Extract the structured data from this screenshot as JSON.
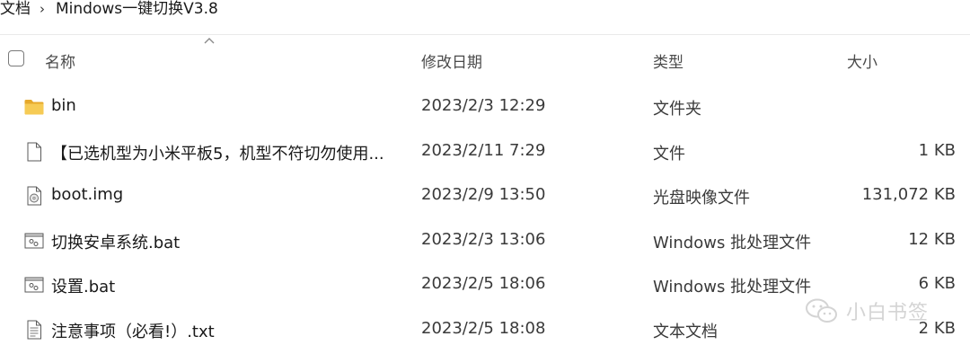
{
  "breadcrumb": {
    "items": [
      "文档",
      "Mindows一键切换V3.8"
    ],
    "separator": "›"
  },
  "columns": {
    "name": "名称",
    "date_modified": "修改日期",
    "type": "类型",
    "size": "大小"
  },
  "files": [
    {
      "icon": "folder-icon",
      "name": "bin",
      "date": "2023/2/3 12:29",
      "type": "文件夹",
      "size": ""
    },
    {
      "icon": "file-icon",
      "name": "【已选机型为小米平板5，机型不符切勿使用...",
      "date": "2023/2/11 7:29",
      "type": "文件",
      "size": "1 KB"
    },
    {
      "icon": "disc-image-icon",
      "name": "boot.img",
      "date": "2023/2/9 13:50",
      "type": "光盘映像文件",
      "size": "131,072 KB"
    },
    {
      "icon": "batch-file-icon",
      "name": "切换安卓系统.bat",
      "date": "2023/2/3 13:06",
      "type": "Windows 批处理文件",
      "size": "12 KB"
    },
    {
      "icon": "batch-file-icon",
      "name": "设置.bat",
      "date": "2023/2/5 18:06",
      "type": "Windows 批处理文件",
      "size": "6 KB"
    },
    {
      "icon": "text-file-icon",
      "name": "注意事项（必看!）.txt",
      "date": "2023/2/5 18:08",
      "type": "文本文档",
      "size": "2 KB"
    }
  ],
  "watermark": {
    "text": "小白书签",
    "icon": "wechat-icon"
  },
  "colors": {
    "folder": "#F4C64F",
    "folder_dark": "#E6A92B",
    "text": "#1a1a1a",
    "secondary_text": "#4a4a4a"
  }
}
